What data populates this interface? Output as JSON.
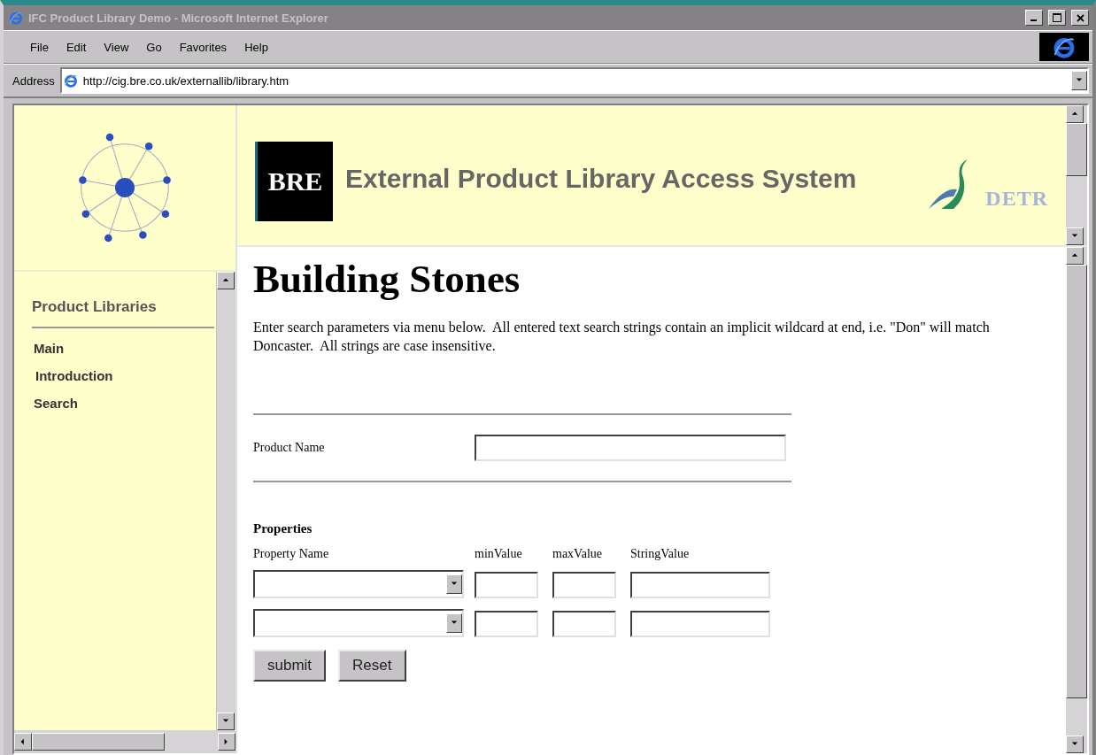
{
  "window": {
    "title": "IFC Product Library Demo - Microsoft Internet Explorer"
  },
  "menu": [
    "File",
    "Edit",
    "View",
    "Go",
    "Favorites",
    "Help"
  ],
  "address": {
    "label": "Address",
    "url": "http://cig.bre.co.uk/externallib/library.htm"
  },
  "sidebar": {
    "heading": "Product Libraries",
    "items": [
      "Main",
      "Introduction",
      "Search"
    ]
  },
  "header": {
    "logo": "BRE",
    "title": "External Product Library Access System",
    "partner": "DETR"
  },
  "main": {
    "heading": "Building Stones",
    "intro": "Enter search parameters via menu below.  All entered text search strings contain an implicit wildcard at end, i.e. \"Don\" will match Doncaster.  All strings are case insensitive.",
    "product_name": {
      "label": "Product Name"
    },
    "properties": {
      "heading": "Properties",
      "columns": [
        "Property Name",
        "minValue",
        "maxValue",
        "StringValue"
      ],
      "rows": [
        {
          "kind": "select-row"
        },
        {
          "kind": "select-row"
        }
      ]
    },
    "buttons": [
      "submit",
      "Reset"
    ]
  }
}
